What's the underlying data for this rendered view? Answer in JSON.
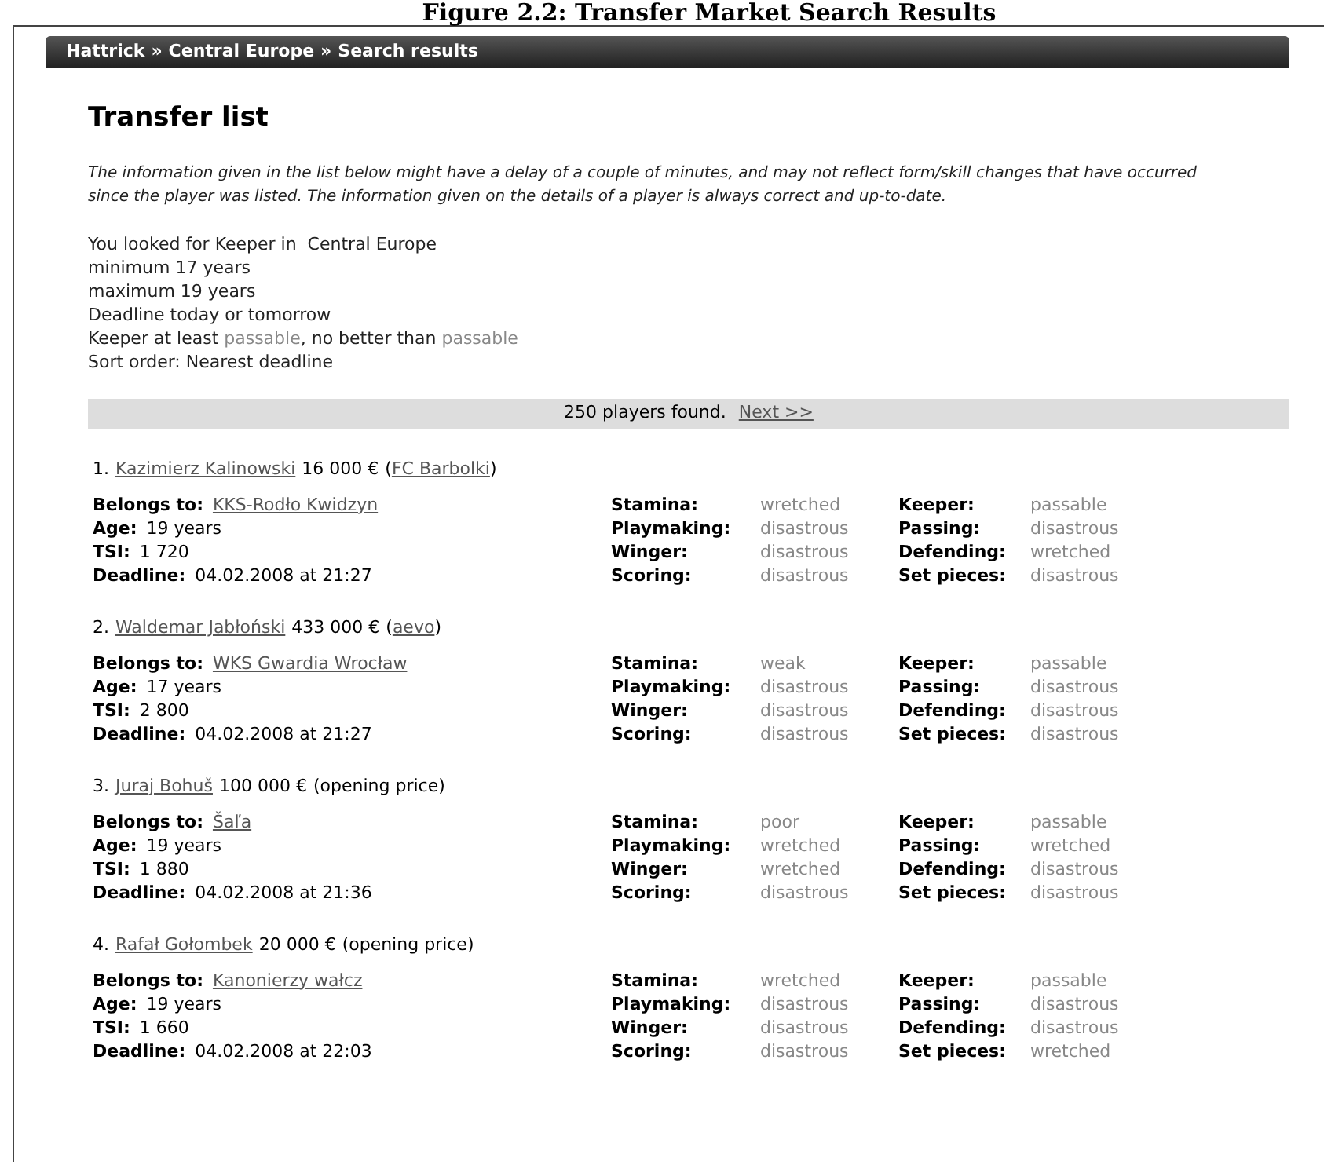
{
  "caption": "Figure 2.2: Transfer Market Search Results",
  "breadcrumb": [
    {
      "label": "Hattrick"
    },
    {
      "label": "Central Europe"
    },
    {
      "label": "Search results"
    }
  ],
  "breadcrumb_separator": "»",
  "title": "Transfer list",
  "notice": "The information given in the list below might have a delay of a couple of minutes, and may not reflect form/skill changes that have occurred since the player was listed. The information given on the details of a player is always correct and up-to-date.",
  "criteria": [
    {
      "parts": [
        {
          "text": "You looked for Keeper in  Central Europe",
          "kind": "plain"
        }
      ]
    },
    {
      "parts": [
        {
          "text": "minimum 17 years",
          "kind": "plain"
        }
      ]
    },
    {
      "parts": [
        {
          "text": "maximum 19 years",
          "kind": "plain"
        }
      ]
    },
    {
      "parts": [
        {
          "text": "Deadline today or tomorrow",
          "kind": "plain"
        }
      ]
    },
    {
      "parts": [
        {
          "text": "Keeper at least ",
          "kind": "plain"
        },
        {
          "text": "passable",
          "kind": "skill"
        },
        {
          "text": ", no better than ",
          "kind": "plain"
        },
        {
          "text": "passable",
          "kind": "skill"
        }
      ]
    },
    {
      "parts": [
        {
          "text": "Sort order: Nearest deadline",
          "kind": "plain"
        }
      ]
    }
  ],
  "results_bar": {
    "count": "250 players found.",
    "next_link": "Next >>"
  },
  "players": [
    {
      "number": "1.",
      "name": "Kazimierz Kalinowski",
      "price": "16 000 €",
      "bidder": {
        "open": "(",
        "name": "FC Barbolki",
        "close": ")"
      },
      "info": [
        {
          "label": "Belongs to:",
          "value": "KKS-Rodło Kwidzyn",
          "kind": "link"
        },
        {
          "label": "Age:",
          "value": "19 years",
          "kind": "plain"
        },
        {
          "label": "TSI:",
          "value": "1 720",
          "kind": "plain"
        },
        {
          "label": "Deadline:",
          "value": "04.02.2008 at 21:27",
          "kind": "plain"
        }
      ],
      "skills": [
        {
          "label": "Stamina:",
          "value": "wretched"
        },
        {
          "label": "Keeper:",
          "value": "passable"
        },
        {
          "label": "Playmaking:",
          "value": "disastrous"
        },
        {
          "label": "Passing:",
          "value": "disastrous"
        },
        {
          "label": "Winger:",
          "value": "disastrous"
        },
        {
          "label": "Defending:",
          "value": "wretched"
        },
        {
          "label": "Scoring:",
          "value": "disastrous"
        },
        {
          "label": "Set pieces:",
          "value": "disastrous"
        }
      ]
    },
    {
      "number": "2.",
      "name": "Waldemar Jabłoński",
      "price": "433 000 €",
      "bidder": {
        "open": "(",
        "name": "aevo",
        "close": ")"
      },
      "info": [
        {
          "label": "Belongs to:",
          "value": "WKS Gwardia Wrocław",
          "kind": "link"
        },
        {
          "label": "Age:",
          "value": "17 years",
          "kind": "plain"
        },
        {
          "label": "TSI:",
          "value": "2 800",
          "kind": "plain"
        },
        {
          "label": "Deadline:",
          "value": "04.02.2008 at 21:27",
          "kind": "plain"
        }
      ],
      "skills": [
        {
          "label": "Stamina:",
          "value": "weak"
        },
        {
          "label": "Keeper:",
          "value": "passable"
        },
        {
          "label": "Playmaking:",
          "value": "disastrous"
        },
        {
          "label": "Passing:",
          "value": "disastrous"
        },
        {
          "label": "Winger:",
          "value": "disastrous"
        },
        {
          "label": "Defending:",
          "value": "disastrous"
        },
        {
          "label": "Scoring:",
          "value": "disastrous"
        },
        {
          "label": "Set pieces:",
          "value": "disastrous"
        }
      ]
    },
    {
      "number": "3.",
      "name": "Juraj Bohuš",
      "price": "100 000 €",
      "note": "(opening price)",
      "info": [
        {
          "label": "Belongs to:",
          "value": "Šaľa",
          "kind": "link"
        },
        {
          "label": "Age:",
          "value": "19 years",
          "kind": "plain"
        },
        {
          "label": "TSI:",
          "value": "1 880",
          "kind": "plain"
        },
        {
          "label": "Deadline:",
          "value": "04.02.2008 at 21:36",
          "kind": "plain"
        }
      ],
      "skills": [
        {
          "label": "Stamina:",
          "value": "poor"
        },
        {
          "label": "Keeper:",
          "value": "passable"
        },
        {
          "label": "Playmaking:",
          "value": "wretched"
        },
        {
          "label": "Passing:",
          "value": "wretched"
        },
        {
          "label": "Winger:",
          "value": "wretched"
        },
        {
          "label": "Defending:",
          "value": "disastrous"
        },
        {
          "label": "Scoring:",
          "value": "disastrous"
        },
        {
          "label": "Set pieces:",
          "value": "disastrous"
        }
      ]
    },
    {
      "number": "4.",
      "name": "Rafał Gołombek",
      "price": "20 000 €",
      "note": "(opening price)",
      "info": [
        {
          "label": "Belongs to:",
          "value": "Kanonierzy wałcz",
          "kind": "link"
        },
        {
          "label": "Age:",
          "value": "19 years",
          "kind": "plain"
        },
        {
          "label": "TSI:",
          "value": "1 660",
          "kind": "plain"
        },
        {
          "label": "Deadline:",
          "value": "04.02.2008 at 22:03",
          "kind": "plain"
        }
      ],
      "skills": [
        {
          "label": "Stamina:",
          "value": "wretched"
        },
        {
          "label": "Keeper:",
          "value": "passable"
        },
        {
          "label": "Playmaking:",
          "value": "disastrous"
        },
        {
          "label": "Passing:",
          "value": "disastrous"
        },
        {
          "label": "Winger:",
          "value": "disastrous"
        },
        {
          "label": "Defending:",
          "value": "disastrous"
        },
        {
          "label": "Scoring:",
          "value": "disastrous"
        },
        {
          "label": "Set pieces:",
          "value": "wretched"
        }
      ]
    }
  ]
}
